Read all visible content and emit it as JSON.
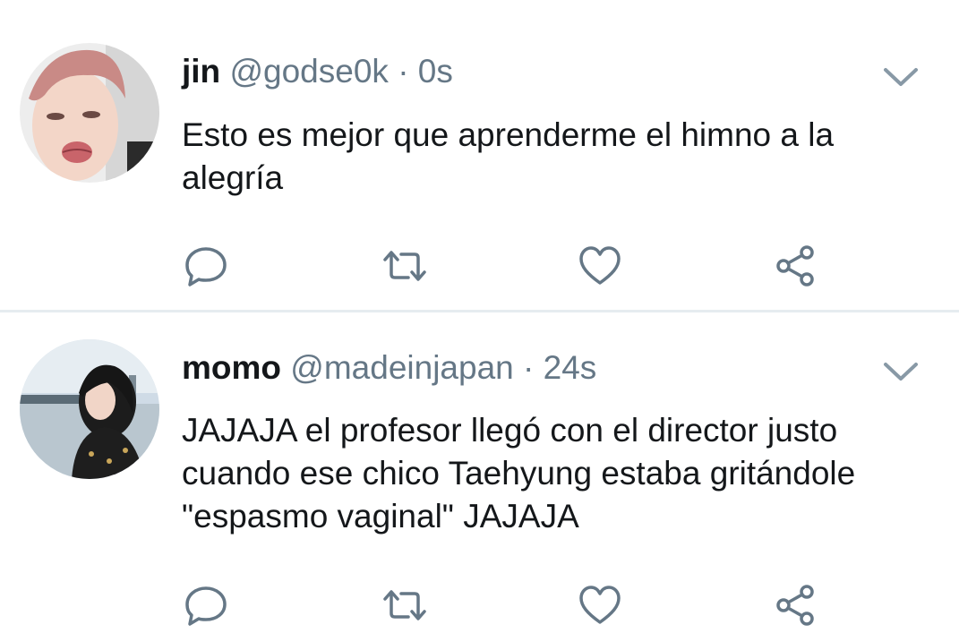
{
  "tweets": [
    {
      "name": "jin",
      "handle": "@godse0k",
      "separator": "·",
      "time": "0s",
      "text": "Esto es mejor que aprenderme el himno a la alegría"
    },
    {
      "name": "momo",
      "handle": "@madeinjapan",
      "separator": "·",
      "time": "24s",
      "text": "JAJAJA el profesor llegó con el director justo cuando ese chico Taehyung estaba gritándole \"espasmo vaginal\" JAJAJA"
    }
  ],
  "icons": {
    "menu": "chevron-down-icon",
    "reply": "reply-icon",
    "retweet": "retweet-icon",
    "like": "heart-icon",
    "share": "share-icon"
  },
  "colors": {
    "text": "#14171a",
    "muted": "#657786",
    "divider": "#e6ecf0"
  }
}
